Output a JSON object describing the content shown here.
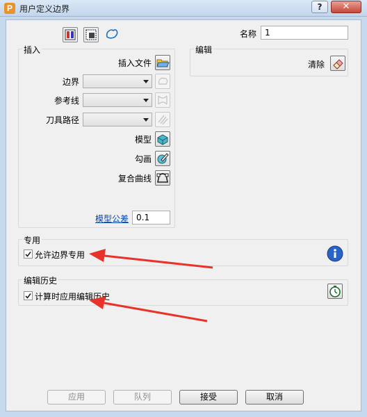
{
  "window": {
    "title": "用户定义边界",
    "app_icon_letter": "P",
    "help_label": "?",
    "close_label": "✕"
  },
  "toolbar": {
    "icons": [
      "boundary-type-icon",
      "select-region-icon",
      "curve-shape-icon"
    ]
  },
  "name": {
    "label": "名称",
    "value": "1"
  },
  "insert": {
    "title": "插入",
    "insert_file_label": "插入文件",
    "boundary_label": "边界",
    "reference_label": "参考线",
    "toolpath_label": "刀具路径",
    "model_label": "模型",
    "sketch_label": "勾画",
    "composite_curve_label": "复合曲线",
    "tolerance_link": "模型公差",
    "tolerance_value": "0.1"
  },
  "edit": {
    "title": "编辑",
    "clear_label": "清除"
  },
  "private": {
    "title": "专用",
    "checkbox_label": "允许边界专用",
    "checked": true
  },
  "history": {
    "title": "编辑历史",
    "checkbox_label": "计算时应用编辑历史",
    "checked": true
  },
  "buttons": {
    "apply": "应用",
    "queue": "队列",
    "accept": "接受",
    "cancel": "取消"
  },
  "colors": {
    "annotation_arrow": "#e8322a",
    "info_blue": "#2a63c8",
    "close_red": "#c7473a"
  }
}
